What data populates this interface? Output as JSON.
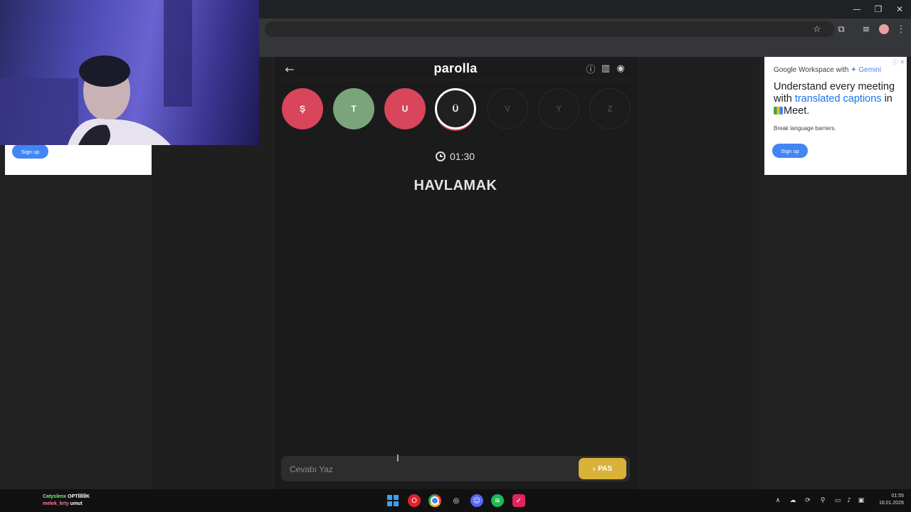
{
  "game": {
    "logo": "parolla",
    "letters": [
      {
        "char": "Ş",
        "state": "wrong"
      },
      {
        "char": "T",
        "state": "correct"
      },
      {
        "char": "U",
        "state": "wrong"
      },
      {
        "char": "Ü",
        "state": "active"
      },
      {
        "char": "V",
        "state": "pending"
      },
      {
        "char": "Y",
        "state": "pending"
      },
      {
        "char": "Z",
        "state": "pending"
      }
    ],
    "timer": "01:30",
    "clue": "HAVLAMAK",
    "answer_placeholder": "Cevabı Yaz",
    "pass_label": "PAS",
    "colors": {
      "wrong": "#d9455a",
      "correct": "#7aa57c",
      "pass": "#d9b23a"
    }
  },
  "ads": {
    "left": {
      "signup": "Sign up"
    },
    "right": {
      "brand_prefix": "Google Workspace with ",
      "brand_gemini": "✦ Gemini",
      "headline_1": "Understand every meeting with ",
      "headline_highlight": "translated captions",
      "headline_2": " in ",
      "headline_meet": "Meet.",
      "subtext": "Break language barriers.",
      "signup": "Sign up"
    }
  },
  "chat": [
    {
      "user": "Catyslenx",
      "message": "OPTİİİİİİK"
    },
    {
      "user": "melek_krty",
      "message": "umut"
    }
  ],
  "taskbar": {
    "time": "01:55",
    "date": "16.01.2026"
  }
}
